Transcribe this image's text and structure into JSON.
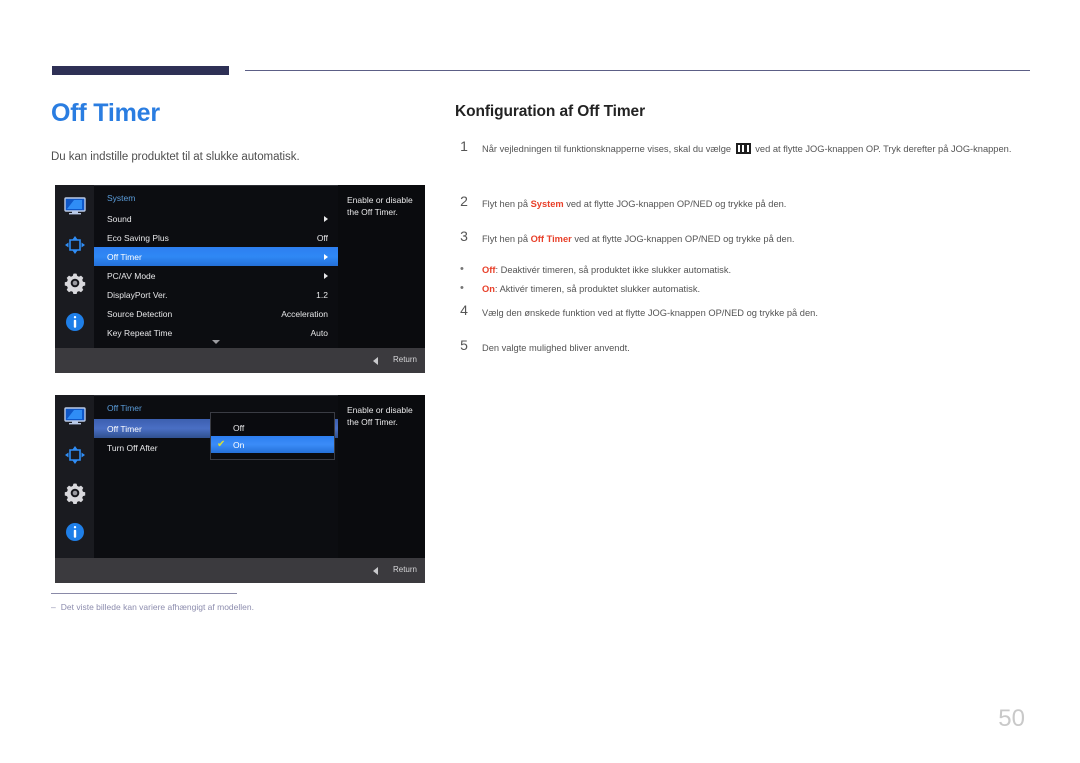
{
  "page": {
    "title": "Off Timer",
    "intro": "Du kan indstille produktet til at slukke automatisk.",
    "number": "50",
    "footnote_dash": "‒",
    "footnote": "Det viste billede kan variere afhængigt af modellen."
  },
  "colors": {
    "title_blue": "#2a7de1",
    "highlight_red": "#e8402a",
    "header_bar": "#2e3055",
    "osd_selected": "#2d7ef0"
  },
  "osd1": {
    "section_title": "System",
    "help_text": "Enable or disable the Off Timer.",
    "return_label": "Return",
    "rail_icons": [
      "monitor-icon",
      "picture-adjust-icon",
      "gear-icon",
      "info-icon"
    ],
    "rows": [
      {
        "label": "Sound",
        "value": "",
        "arrow": true,
        "selected": false
      },
      {
        "label": "Eco Saving Plus",
        "value": "Off",
        "arrow": false,
        "selected": false
      },
      {
        "label": "Off Timer",
        "value": "",
        "arrow": true,
        "selected": true
      },
      {
        "label": "PC/AV Mode",
        "value": "",
        "arrow": true,
        "selected": false
      },
      {
        "label": "DisplayPort Ver.",
        "value": "1.2",
        "arrow": false,
        "selected": false
      },
      {
        "label": "Source Detection",
        "value": "Acceleration",
        "arrow": false,
        "selected": false
      },
      {
        "label": "Key Repeat Time",
        "value": "Auto",
        "arrow": false,
        "selected": false
      }
    ]
  },
  "osd2": {
    "section_title": "Off Timer",
    "help_text": "Enable or disable the Off Timer.",
    "return_label": "Return",
    "rail_icons": [
      "monitor-icon",
      "picture-adjust-icon",
      "gear-icon",
      "info-icon"
    ],
    "rows": [
      {
        "label": "Off Timer",
        "selected": true
      },
      {
        "label": "Turn Off After",
        "selected": false
      }
    ],
    "popup": [
      {
        "label": "Off",
        "checked": false,
        "selected": false
      },
      {
        "label": "On",
        "checked": true,
        "selected": true
      }
    ],
    "check_glyph": "✔"
  },
  "right": {
    "title": "Konfiguration af Off Timer",
    "steps": [
      {
        "num": "1",
        "pre": "Når vejledningen til funktionsknapperne vises, skal du vælge ",
        "icon": "jog-menu-icon",
        "post": " ved at flytte JOG-knappen OP. Tryk derefter på JOG-knappen."
      },
      {
        "num": "2",
        "pre": "Flyt hen på ",
        "hl": "System",
        "post": " ved at flytte JOG-knappen OP/NED og trykke på den."
      },
      {
        "num": "3",
        "pre": "Flyt hen på ",
        "hl": "Off Timer",
        "post": " ved at flytte JOG-knappen OP/NED og trykke på den."
      }
    ],
    "bullets": [
      {
        "dot": "•",
        "hl": "Off",
        "post": ": Deaktivér timeren, så produktet ikke slukker automatisk."
      },
      {
        "dot": "•",
        "hl": "On",
        "post": ": Aktivér timeren, så produktet slukker automatisk."
      }
    ],
    "steps_tail": [
      {
        "num": "4",
        "text": "Vælg den ønskede funktion ved at flytte JOG-knappen OP/NED og trykke på den."
      },
      {
        "num": "5",
        "text": "Den valgte mulighed bliver anvendt."
      }
    ]
  }
}
